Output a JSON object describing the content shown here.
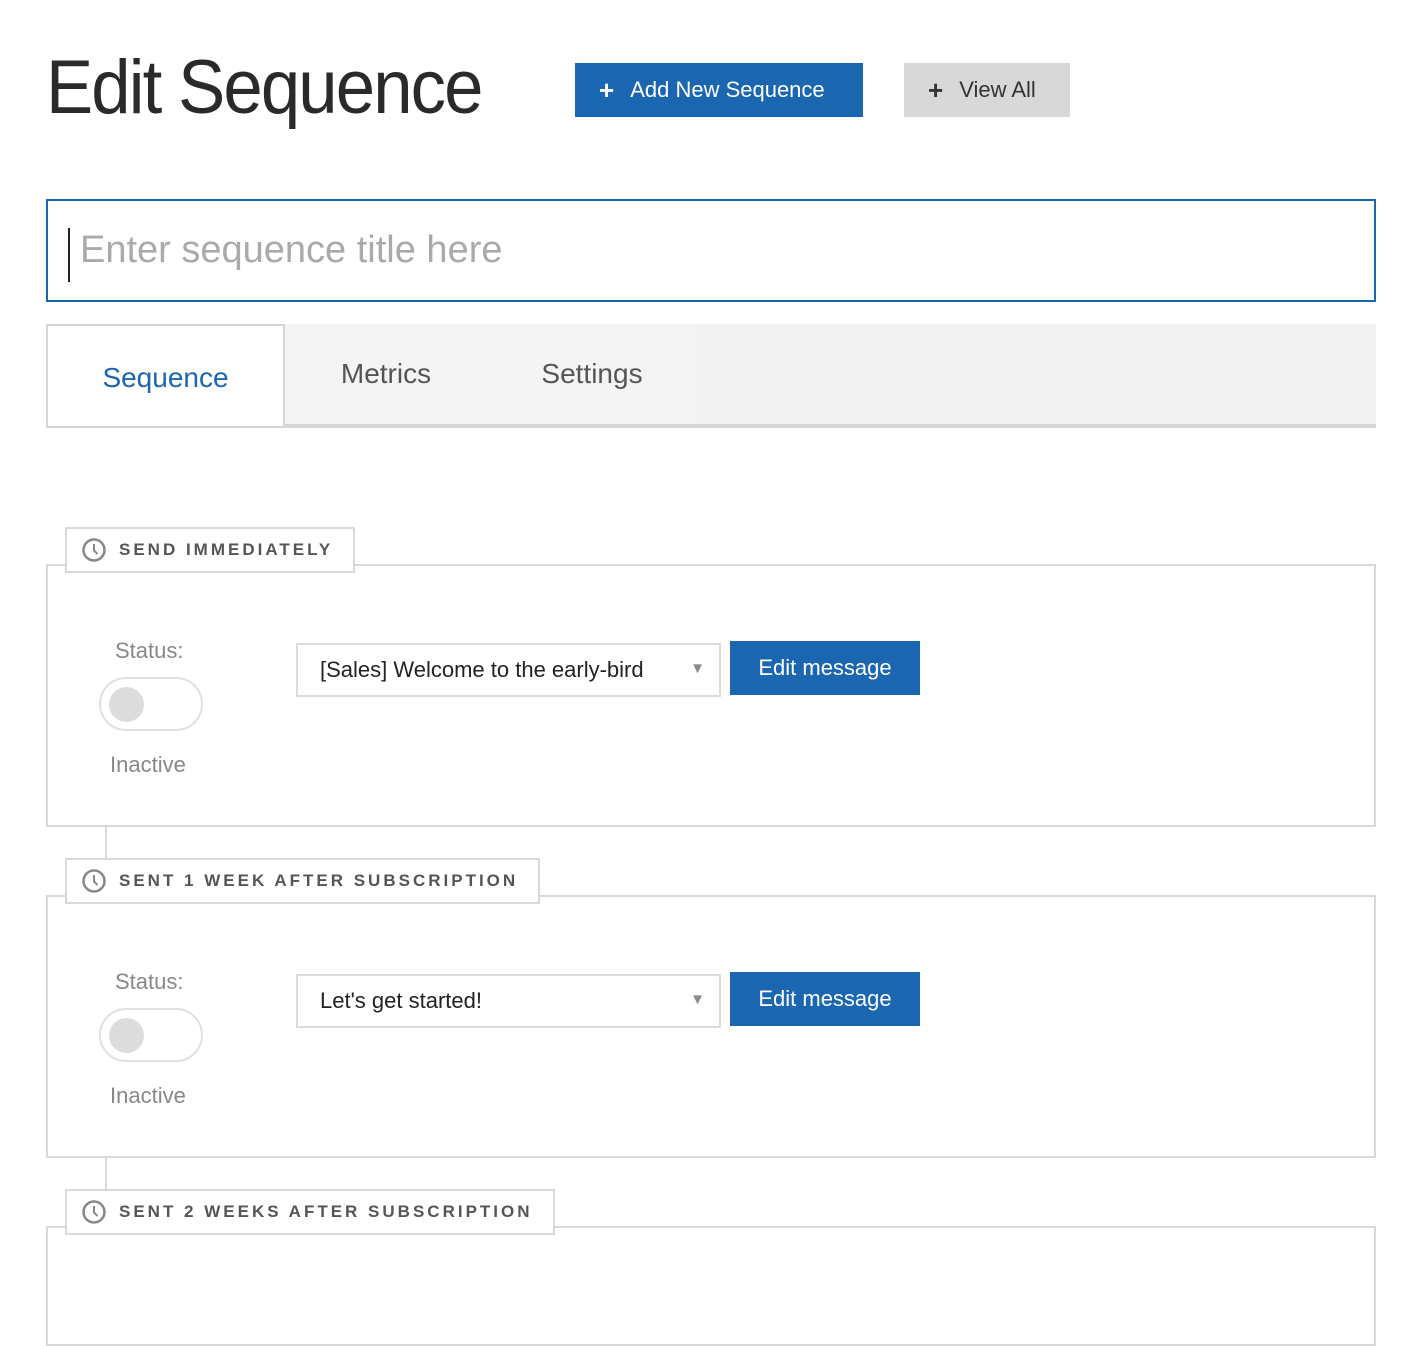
{
  "header": {
    "title": "Edit Sequence",
    "add_button": "Add New Sequence",
    "view_all_button": "View All"
  },
  "title_input": {
    "value": "",
    "placeholder": "Enter sequence title here"
  },
  "tabs": [
    {
      "label": "Sequence",
      "active": true
    },
    {
      "label": "Metrics",
      "active": false
    },
    {
      "label": "Settings",
      "active": false
    }
  ],
  "steps": [
    {
      "timing": "SEND IMMEDIATELY",
      "status_label": "Status:",
      "status": "Inactive",
      "message": "[Sales] Welcome to the early-bird",
      "edit_button": "Edit message"
    },
    {
      "timing": "SENT 1 WEEK AFTER SUBSCRIPTION",
      "status_label": "Status:",
      "status": "Inactive",
      "message": "Let's get started!",
      "edit_button": "Edit message"
    },
    {
      "timing": "SENT 2 WEEKS AFTER SUBSCRIPTION"
    }
  ],
  "icons": {
    "plus": "+",
    "dropdown_arrow": "▼",
    "clock": "clock-icon"
  },
  "colors": {
    "primary": "#1a66b0",
    "secondary_button": "#d8d8d8",
    "border": "#d9d9d9"
  }
}
